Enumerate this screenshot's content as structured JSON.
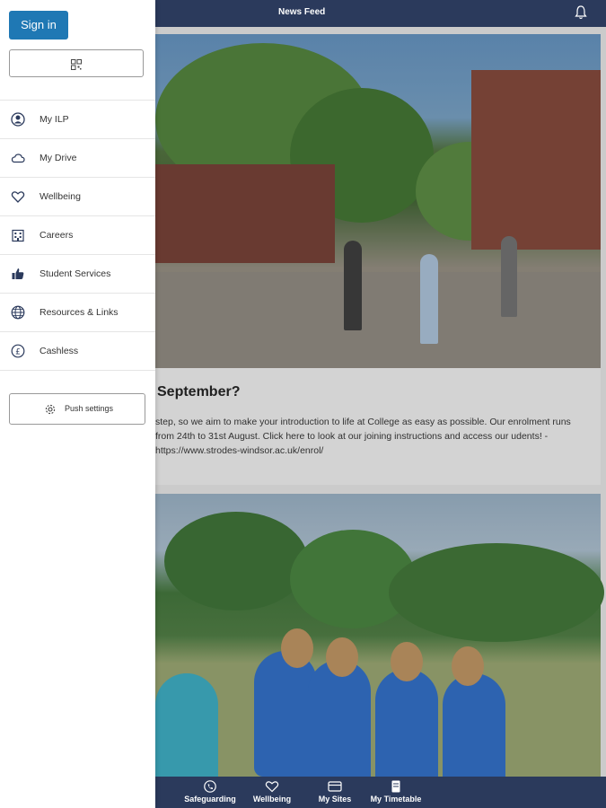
{
  "header": {
    "title": "News Feed",
    "bell_icon": "bell-icon"
  },
  "drawer": {
    "sign_in_label": "Sign in",
    "qr_icon": "qr-code-icon",
    "menu": [
      {
        "label": "My ILP",
        "icon": "user-circle-icon"
      },
      {
        "label": "My Drive",
        "icon": "cloud-icon"
      },
      {
        "label": "Wellbeing",
        "icon": "heart-icon"
      },
      {
        "label": "Careers",
        "icon": "building-icon"
      },
      {
        "label": "Student Services",
        "icon": "thumbs-up-icon"
      },
      {
        "label": "Resources & Links",
        "icon": "globe-icon"
      },
      {
        "label": "Cashless",
        "icon": "pound-icon"
      }
    ],
    "push_settings_label": "Push settings",
    "push_settings_icon": "gear-icon"
  },
  "feed": {
    "post1": {
      "title": "September?",
      "body": "step, so we aim to make your introduction to life at College as easy as possible. Our enrolment runs from 24th to 31st August. Click here to look at our joining instructions and access our udents! - https://www.strodes-windsor.ac.uk/enrol/"
    }
  },
  "bottom_nav": [
    {
      "label": "Safeguarding",
      "icon": "phone-icon"
    },
    {
      "label": "Wellbeing",
      "icon": "heart-icon"
    },
    {
      "label": "My Sites",
      "icon": "sites-icon"
    },
    {
      "label": "My Timetable",
      "icon": "timetable-icon"
    }
  ],
  "colors": {
    "navbar": "#2b3a5c",
    "signin": "#1f78b4",
    "icon": "#2b3a5c"
  }
}
